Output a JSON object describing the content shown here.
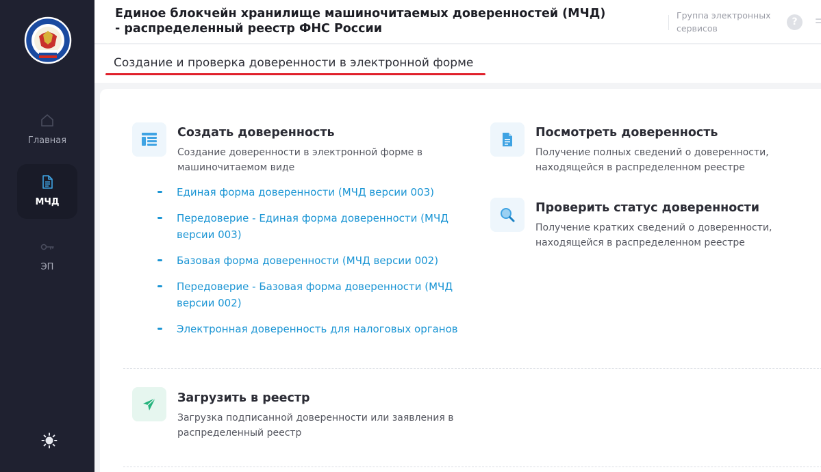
{
  "header": {
    "title": "Единое блокчейн хранилище машиночитаемых доверенностей (МЧД) - распределенный реестр ФНС России",
    "group_services": "Группа электронных сервисов",
    "help_label": "?"
  },
  "sidebar": {
    "items": [
      {
        "label": "Главная",
        "icon": "home-icon"
      },
      {
        "label": "МЧД",
        "icon": "document-icon",
        "active": true
      },
      {
        "label": "ЭП",
        "icon": "key-icon"
      }
    ],
    "theme_icon": "sun-icon"
  },
  "subheader": {
    "title": "Создание и проверка доверенности в электронной форме"
  },
  "services": {
    "create": {
      "title": "Создать доверенность",
      "description": "Создание доверенности в электронной форме в машиночитаемом виде",
      "links": [
        "Единая форма доверенности (МЧД версии 003)",
        "Передоверие - Единая форма доверенности (МЧД версии 003)",
        "Базовая форма доверенности (МЧД версии 002)",
        "Передоверие - Базовая форма доверенности (МЧД версии 002)",
        "Электронная доверенность для налоговых органов"
      ]
    },
    "view": {
      "title": "Посмотреть доверенность",
      "description": "Получение полных сведений о доверенности, находящейся в распределенном реестре"
    },
    "check": {
      "title": "Проверить статус доверенности",
      "description": "Получение кратких сведений о доверенности, находящейся в распределенном реестре"
    },
    "upload": {
      "title": "Загрузить в реестр",
      "description": "Загрузка подписанной доверенности или заявления в распределенный реестр"
    }
  },
  "colors": {
    "sidebar_bg": "#1f2130",
    "accent_link": "#1b95d4",
    "underline_red": "#e0202b",
    "upload_icon_green": "#25b37d"
  }
}
